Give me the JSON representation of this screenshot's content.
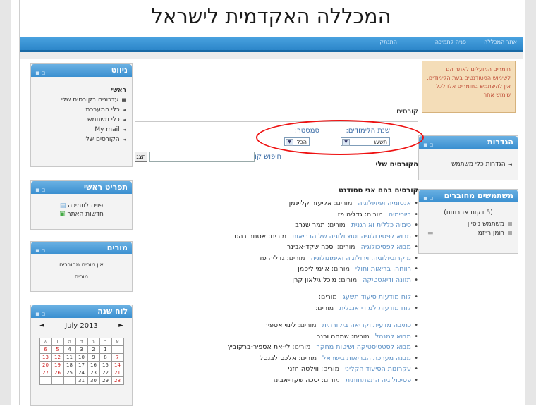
{
  "site_title": "המכללה האקדמית לישראל",
  "nav": {
    "home": "אתר המכללה",
    "support": "פניה לתמיכה",
    "logout": "התנתק"
  },
  "notice": "חומרים המועלים לאתר הם לשימוש הסטודנטים בעת הלימודים. אין להשתמש בחומרים אלו לכל שימוש אחר",
  "navigation": {
    "title": "ניווט",
    "main": "ראשי",
    "items": [
      "עדכונים בקורסים שלי",
      "כלי המערכת",
      "כלי משתמש",
      "My mail",
      "הקורסים שלי"
    ]
  },
  "settings": {
    "title": "הגדרות",
    "item": "הגדרות כלי משתמש"
  },
  "mainmenu": {
    "title": "תפריט ראשי",
    "items": [
      "פניה לתמיכה",
      "חדשות האתר"
    ]
  },
  "online": {
    "title": "משתמשים מחוברים",
    "note": "(5 דקות אחרונות)",
    "users": [
      "משתמש ניסיון",
      "רומן רייזמן"
    ]
  },
  "teachers": {
    "title": "מורים",
    "none": "אין מורים מחוברים",
    "link": "מורים"
  },
  "calendar": {
    "title": "לוח שנה",
    "month": "July 2013",
    "prev": "◄",
    "next": "►",
    "days": [
      "א",
      "ב",
      "ג",
      "ד",
      "ה",
      "ו",
      "ש"
    ],
    "weeks": [
      [
        "",
        "1",
        "2",
        "3",
        "4",
        "5",
        "6"
      ],
      [
        "7",
        "8",
        "9",
        "10",
        "11",
        "12",
        "13"
      ],
      [
        "14",
        "15",
        "16",
        "17",
        "18",
        "19",
        "20"
      ],
      [
        "21",
        "22",
        "23",
        "24",
        "25",
        "26",
        "27"
      ],
      [
        "28",
        "29",
        "30",
        "31",
        "",
        "",
        ""
      ]
    ]
  },
  "courses": {
    "heading": "קורסים",
    "year_label": "שנת הלימודים:",
    "year_value": "תשעג",
    "semester_label": "סמסטר:",
    "semester_value": "הכל",
    "search_label": "חיפוש קורסים:",
    "search_button": "הצג",
    "my_courses": "הקורסים שלי",
    "student_courses": "קורסים בהם אני סטודנט",
    "teacher_word": "מורים:",
    "list": [
      {
        "name": "אנטומיה ופיזיולוגיה",
        "teacher": "אליעזר קליינמן"
      },
      {
        "name": "ביוכימיה",
        "teacher": "גדליה פז"
      },
      {
        "name": "כימיה כללית ואורגנית",
        "teacher": "תמר שגרב"
      },
      {
        "name": "מבוא לפסיכולוגיה וסוציולוגיה של הבריאות",
        "teacher": "אסתר בהט"
      },
      {
        "name": "מבוא לפסיכולוגיה",
        "teacher": "יסכה שקד-אבינר"
      },
      {
        "name": "מיקרוביולוגיה, וירולוגיה ואימונולוגיה",
        "teacher": "גדליה פז"
      },
      {
        "name": "רווחה, בריאות וחולי",
        "teacher": "איימי ליפמן"
      },
      {
        "name": "תזונה ודיאטטיקה",
        "teacher": "מיכל גילאון קרן"
      },
      {
        "gap": true
      },
      {
        "name": "לוח מודעות סיעוד תשעג",
        "teacher": ""
      },
      {
        "name": "לוח מודעות למודי אנגלית",
        "teacher": ""
      },
      {
        "gap": true
      },
      {
        "name": "כתיבה מדעית וקריאה ביקורתית",
        "teacher": "לינוי אספיר"
      },
      {
        "name": "מבוא למנהל",
        "teacher": "שמחה ורנר"
      },
      {
        "name": "מבוא לסטטיסטיקה ושיטות מחקר",
        "teacher": "לי-את אספיר-ברקוביץ"
      },
      {
        "name": "מבנה מערכת הבריאות בישראל",
        "teacher": "אלכס לבנטל"
      },
      {
        "name": "עקרונות הסיעוד הקליני",
        "teacher": "ווילטה חזני"
      },
      {
        "name": "פסיכולוגיה התפתחותית",
        "teacher": "יסכה שקד-אבינר"
      }
    ]
  }
}
